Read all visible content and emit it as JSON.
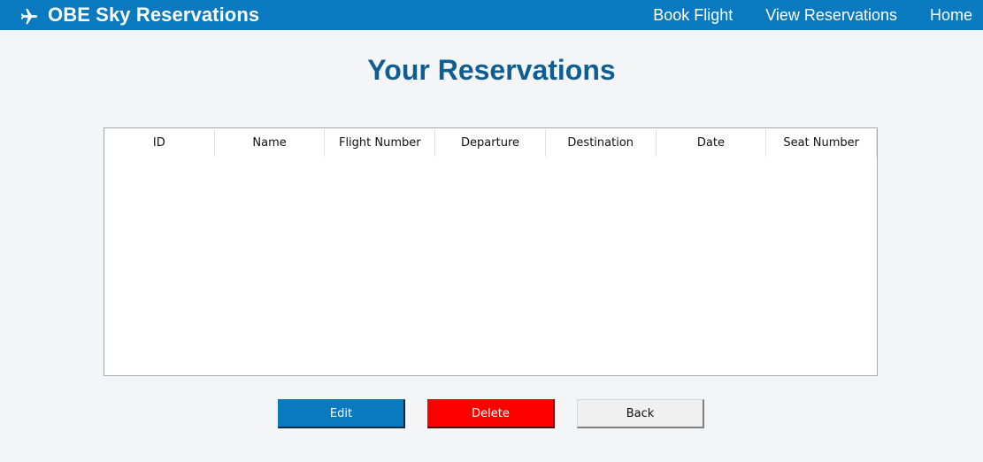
{
  "navbar": {
    "brand": "OBE Sky Reservations",
    "brand_icon": "airplane-icon",
    "links": [
      "Book Flight",
      "View Reservations",
      "Home"
    ]
  },
  "page": {
    "title": "Your Reservations"
  },
  "table": {
    "columns": [
      "ID",
      "Name",
      "Flight Number",
      "Departure",
      "Destination",
      "Date",
      "Seat Number"
    ],
    "rows": []
  },
  "actions": {
    "edit_label": "Edit",
    "delete_label": "Delete",
    "back_label": "Back"
  },
  "colors": {
    "navbar_bg": "#0a7ac0",
    "title": "#0e5e93",
    "edit_bg": "#0a7ac0",
    "delete_bg": "#ff0000"
  }
}
